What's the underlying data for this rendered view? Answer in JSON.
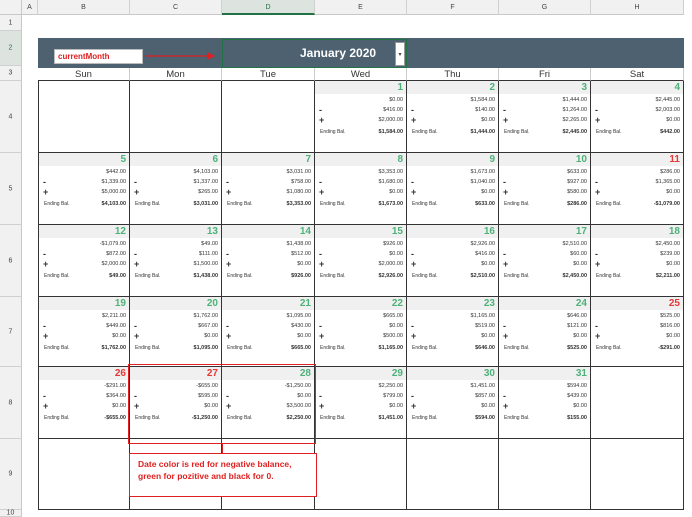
{
  "sheet": {
    "columns": [
      "A",
      "B",
      "C",
      "D",
      "E",
      "F",
      "G",
      "H"
    ],
    "selected_column": "D",
    "rows": [
      "1",
      "2",
      "3",
      "4",
      "5",
      "6",
      "7",
      "8",
      "9",
      "10"
    ],
    "selected_row": "2"
  },
  "header": {
    "current_month_label": "currentMonth",
    "month_title": "January 2020",
    "dropdown_icon": "chevron-down-icon"
  },
  "weekdays": [
    "Sun",
    "Mon",
    "Tue",
    "Wed",
    "Thu",
    "Fri",
    "Sat"
  ],
  "ending_label": "Ending Bal.",
  "days": [
    {
      "n": "1",
      "c": "pos",
      "v": [
        "$0.00",
        "$416.00",
        "$2,000.00",
        "$1,584.00"
      ]
    },
    {
      "n": "2",
      "c": "pos",
      "v": [
        "$1,584.00",
        "$140.00",
        "$0.00",
        "$1,444.00"
      ]
    },
    {
      "n": "3",
      "c": "pos",
      "v": [
        "$1,444.00",
        "$1,264.00",
        "$2,265.00",
        "$2,445.00"
      ]
    },
    {
      "n": "4",
      "c": "pos",
      "v": [
        "$2,445.00",
        "$2,003.00",
        "$0.00",
        "$442.00"
      ]
    },
    {
      "n": "5",
      "c": "pos",
      "v": [
        "$442.00",
        "$1,339.00",
        "$5,000.00",
        "$4,103.00"
      ]
    },
    {
      "n": "6",
      "c": "pos",
      "v": [
        "$4,103.00",
        "$1,337.00",
        "$265.00",
        "$3,031.00"
      ]
    },
    {
      "n": "7",
      "c": "pos",
      "v": [
        "$3,031.00",
        "$758.00",
        "$1,080.00",
        "$3,353.00"
      ]
    },
    {
      "n": "8",
      "c": "pos",
      "v": [
        "$3,353.00",
        "$1,680.00",
        "$0.00",
        "$1,673.00"
      ]
    },
    {
      "n": "9",
      "c": "pos",
      "v": [
        "$1,673.00",
        "$1,040.00",
        "$0.00",
        "$633.00"
      ]
    },
    {
      "n": "10",
      "c": "pos",
      "v": [
        "$633.00",
        "$927.00",
        "$580.00",
        "$286.00"
      ]
    },
    {
      "n": "11",
      "c": "neg",
      "v": [
        "$286.00",
        "$1,365.00",
        "$0.00",
        "-$1,079.00"
      ]
    },
    {
      "n": "12",
      "c": "pos",
      "v": [
        "-$1,079.00",
        "$872.00",
        "$2,000.00",
        "$49.00"
      ]
    },
    {
      "n": "13",
      "c": "pos",
      "v": [
        "$49.00",
        "$111.00",
        "$1,500.00",
        "$1,438.00"
      ]
    },
    {
      "n": "14",
      "c": "pos",
      "v": [
        "$1,438.00",
        "$512.00",
        "$0.00",
        "$926.00"
      ]
    },
    {
      "n": "15",
      "c": "pos",
      "v": [
        "$926.00",
        "$0.00",
        "$2,000.00",
        "$2,926.00"
      ]
    },
    {
      "n": "16",
      "c": "pos",
      "v": [
        "$2,926.00",
        "$416.00",
        "$0.00",
        "$2,510.00"
      ]
    },
    {
      "n": "17",
      "c": "pos",
      "v": [
        "$2,510.00",
        "$60.00",
        "$0.00",
        "$2,450.00"
      ]
    },
    {
      "n": "18",
      "c": "pos",
      "v": [
        "$2,450.00",
        "$239.00",
        "$0.00",
        "$2,211.00"
      ]
    },
    {
      "n": "19",
      "c": "pos",
      "v": [
        "$2,211.00",
        "$449.00",
        "$0.00",
        "$1,762.00"
      ]
    },
    {
      "n": "20",
      "c": "pos",
      "v": [
        "$1,762.00",
        "$667.00",
        "$0.00",
        "$1,095.00"
      ]
    },
    {
      "n": "21",
      "c": "pos",
      "v": [
        "$1,095.00",
        "$430.00",
        "$0.00",
        "$665.00"
      ]
    },
    {
      "n": "22",
      "c": "pos",
      "v": [
        "$665.00",
        "$0.00",
        "$500.00",
        "$1,165.00"
      ]
    },
    {
      "n": "23",
      "c": "pos",
      "v": [
        "$1,165.00",
        "$519.00",
        "$0.00",
        "$646.00"
      ]
    },
    {
      "n": "24",
      "c": "pos",
      "v": [
        "$646.00",
        "$121.00",
        "$0.00",
        "$525.00"
      ]
    },
    {
      "n": "25",
      "c": "neg",
      "v": [
        "$525.00",
        "$816.00",
        "$0.00",
        "-$291.00"
      ]
    },
    {
      "n": "26",
      "c": "neg",
      "v": [
        "-$291.00",
        "$364.00",
        "$0.00",
        "-$655.00"
      ]
    },
    {
      "n": "27",
      "c": "neg",
      "v": [
        "-$655.00",
        "$595.00",
        "$0.00",
        "-$1,250.00"
      ]
    },
    {
      "n": "28",
      "c": "pos",
      "v": [
        "-$1,250.00",
        "$0.00",
        "$3,500.00",
        "$2,250.00"
      ]
    },
    {
      "n": "29",
      "c": "pos",
      "v": [
        "$2,250.00",
        "$799.00",
        "$0.00",
        "$1,451.00"
      ]
    },
    {
      "n": "30",
      "c": "pos",
      "v": [
        "$1,451.00",
        "$857.00",
        "$0.00",
        "$594.00"
      ]
    },
    {
      "n": "31",
      "c": "pos",
      "v": [
        "$594.00",
        "$439.00",
        "$0.00",
        "$155.00"
      ]
    }
  ],
  "note": {
    "line1": "Date color is red for negative balance,",
    "line2": "green for pozitive and black for 0."
  },
  "colors": {
    "header_band": "#4d6171",
    "positive": "#4db17a",
    "negative": "#e53935",
    "annotation": "#e02020"
  }
}
